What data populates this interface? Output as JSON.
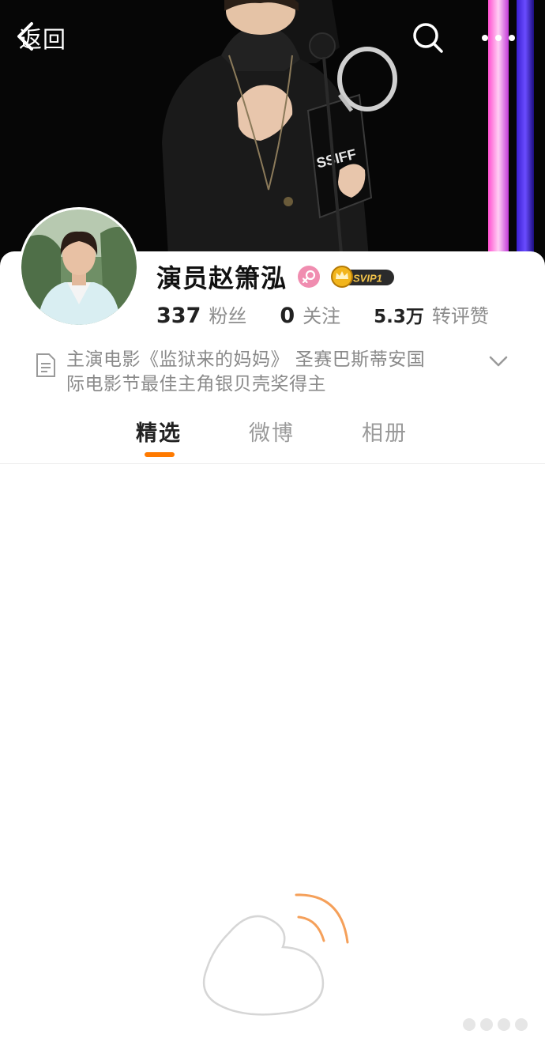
{
  "nav": {
    "back_label": "返回",
    "search_icon": "search-icon",
    "more_icon": "more-icon"
  },
  "profile": {
    "name": "演员赵箫泓",
    "gender_icon": "female-icon",
    "vip_label": "SVIP1",
    "stats": [
      {
        "value": "337",
        "label": "粉丝"
      },
      {
        "value": "0",
        "label": "关注"
      },
      {
        "value": "5.3万",
        "label": "转评赞"
      }
    ],
    "bio_line1": "主演电影《监狱来的妈妈》 圣赛巴斯蒂安国",
    "bio_line2": "际电影节最佳主角银贝壳奖得主"
  },
  "cover": {
    "trophy_text": "SSIFF"
  },
  "tabs": [
    {
      "label": "精选",
      "active": true
    },
    {
      "label": "微博",
      "active": false
    },
    {
      "label": "相册",
      "active": false
    }
  ],
  "colors": {
    "accent": "#ff7a00",
    "vip_gold": "#d9a21b",
    "gender_pink": "#f08db0"
  }
}
